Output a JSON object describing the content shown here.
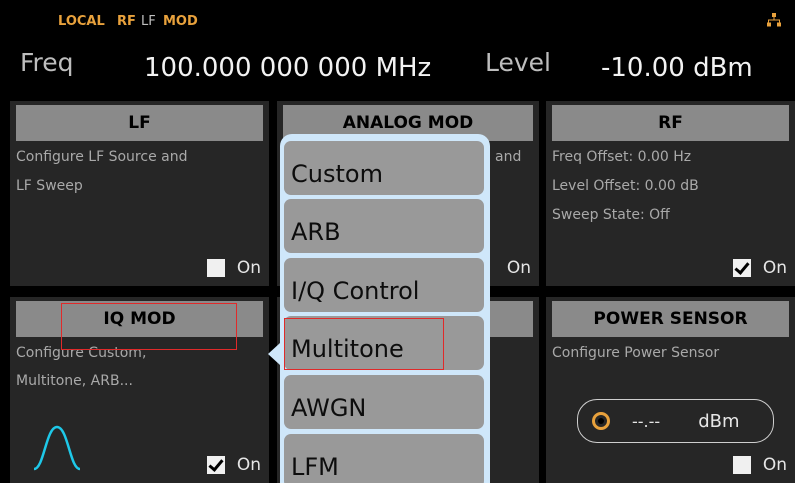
{
  "status": {
    "local": "LOCAL",
    "rf": "RF",
    "lf": "LF",
    "mod": "MOD",
    "network_icon": "network-icon"
  },
  "header": {
    "freq_label": "Freq",
    "freq_value": "100.000 000 000 MHz",
    "level_label": "Level",
    "level_value": "-10.00  dBm"
  },
  "tiles": {
    "lf": {
      "title": "LF",
      "desc": [
        "Configure LF Source and",
        "LF Sweep"
      ],
      "on_label": "On",
      "checked": false
    },
    "analog_mod": {
      "title": "ANALOG MOD",
      "desc_peek": "and",
      "on_label": "On"
    },
    "rf": {
      "title": "RF",
      "desc": [
        "Freq Offset: 0.00 Hz",
        "Level Offset: 0.00 dB",
        "Sweep State: Off"
      ],
      "on_label": "On",
      "checked": true
    },
    "iq_mod": {
      "title": "IQ MOD",
      "desc": [
        "Configure Custom,",
        "Multitone, ARB..."
      ],
      "on_label": "On",
      "checked": true,
      "icon": "sine-wave-icon"
    },
    "power_sensor": {
      "title": "POWER SENSOR",
      "desc": [
        "Configure Power Sensor"
      ],
      "reading": "--.--",
      "unit": "dBm",
      "on_label": "On",
      "checked": false
    }
  },
  "popup_menu": {
    "items": [
      "Custom",
      "ARB",
      "I/Q Control",
      "Multitone",
      "AWGN",
      "LFM"
    ],
    "highlighted": "Multitone"
  },
  "colors": {
    "accent": "#e8a13c",
    "highlight": "#e02a2a",
    "popup_bg": "#cfe7fa",
    "tile_bg": "#262626",
    "title_bg": "#8a8a8a"
  }
}
